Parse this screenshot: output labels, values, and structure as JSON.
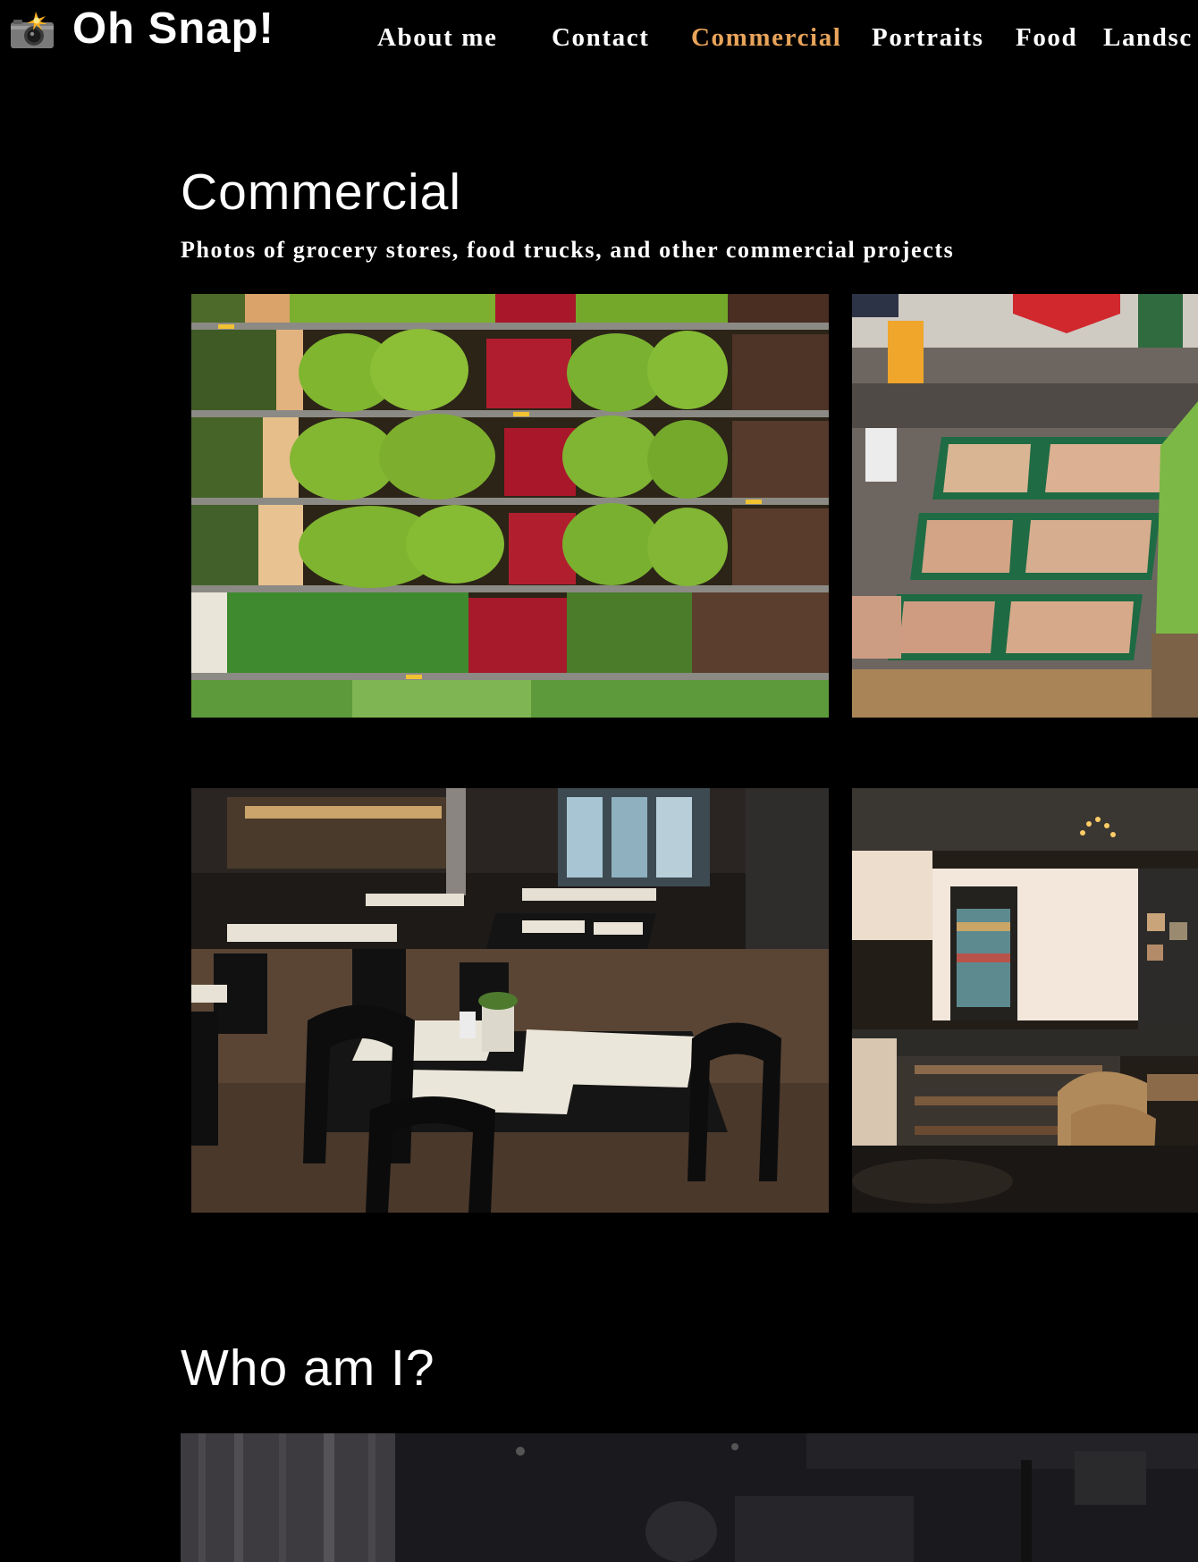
{
  "header": {
    "brand": "Oh Snap!",
    "brand_icon": "camera-flash-icon"
  },
  "nav": {
    "items": [
      {
        "label": "About me",
        "active": false
      },
      {
        "label": "Contact",
        "active": false
      },
      {
        "label": "Commercial",
        "active": true
      },
      {
        "label": "Portraits",
        "active": false
      },
      {
        "label": "Food",
        "active": false
      },
      {
        "label": "Landsc",
        "active": false
      }
    ],
    "active_color": "#E8A45A"
  },
  "commercial": {
    "title": "Commercial",
    "subtitle": "Photos of grocery stores, food trucks, and other commercial projects",
    "photos": [
      {
        "subject": "grocery-produce-shelves"
      },
      {
        "subject": "grocery-fruit-crates"
      },
      {
        "subject": "restaurant-dining-tables"
      },
      {
        "subject": "cafe-bar-counter"
      }
    ]
  },
  "about": {
    "title": "Who am I?"
  },
  "colors": {
    "background": "#000000",
    "text": "#FFFFFF",
    "accent": "#E8A45A"
  }
}
